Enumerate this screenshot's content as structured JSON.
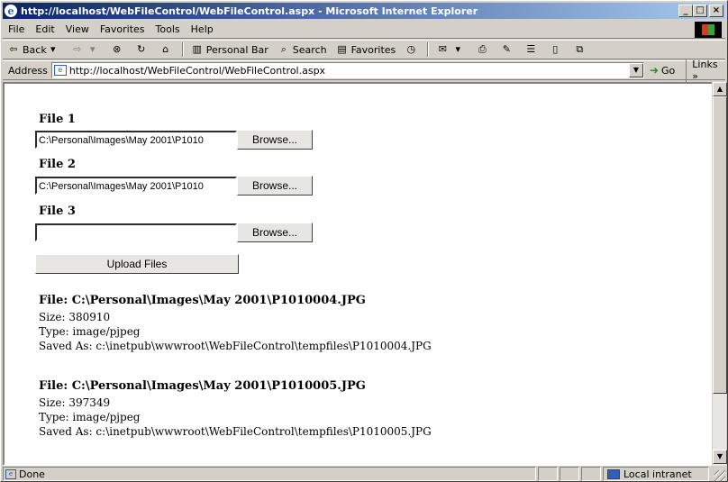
{
  "window": {
    "title": "http://localhost/WebFileControl/WebFileControl.aspx - Microsoft Internet Explorer",
    "min": "_",
    "max": "□",
    "close": "×"
  },
  "menu": [
    "File",
    "Edit",
    "View",
    "Favorites",
    "Tools",
    "Help"
  ],
  "toolbar": {
    "back": "Back",
    "personal_bar": "Personal Bar",
    "search": "Search",
    "favorites": "Favorites"
  },
  "address": {
    "label": "Address",
    "url": "http://localhost/WebFileControl/WebFileControl.aspx",
    "go": "Go",
    "links": "Links »"
  },
  "form": {
    "file1_label": "File 1",
    "file1_value": "C:\\Personal\\Images\\May 2001\\P1010",
    "file2_label": "File 2",
    "file2_value": "C:\\Personal\\Images\\May 2001\\P1010",
    "file3_label": "File 3",
    "file3_value": "",
    "browse": "Browse...",
    "upload": "Upload Files"
  },
  "results": [
    {
      "title": "File: C:\\Personal\\Images\\May 2001\\P1010004.JPG",
      "size": "Size: 380910",
      "type": "Type: image/pjpeg",
      "saved": "Saved As: c:\\inetpub\\wwwroot\\WebFileControl\\tempfiles\\P1010004.JPG"
    },
    {
      "title": "File: C:\\Personal\\Images\\May 2001\\P1010005.JPG",
      "size": "Size: 397349",
      "type": "Type: image/pjpeg",
      "saved": "Saved As: c:\\inetpub\\wwwroot\\WebFileControl\\tempfiles\\P1010005.JPG"
    }
  ],
  "status": {
    "text": "Done",
    "zone": "Local intranet"
  }
}
